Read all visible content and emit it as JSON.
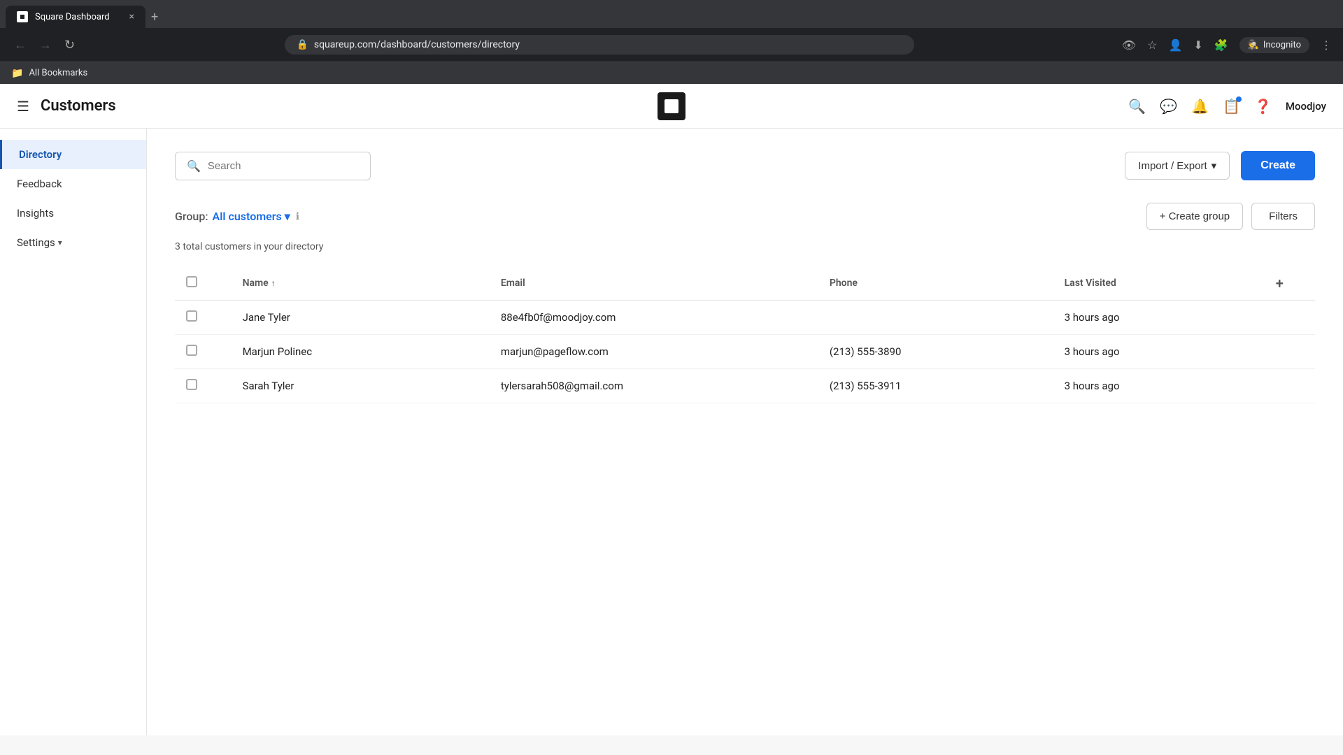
{
  "browser": {
    "tab_title": "Square Dashboard",
    "address": "squareup.com/dashboard/customers/directory",
    "new_tab_label": "+",
    "close_tab": "×",
    "back_btn": "←",
    "forward_btn": "→",
    "refresh_btn": "↻",
    "incognito_label": "Incognito",
    "bookmarks_label": "All Bookmarks"
  },
  "header": {
    "hamburger": "☰",
    "app_title": "Customers",
    "user_name": "Moodjoy"
  },
  "sidebar": {
    "items": [
      {
        "label": "Directory",
        "active": true
      },
      {
        "label": "Feedback",
        "active": false
      },
      {
        "label": "Insights",
        "active": false
      },
      {
        "label": "Settings",
        "active": false
      }
    ]
  },
  "toolbar": {
    "search_placeholder": "Search",
    "import_export_label": "Import / Export",
    "import_export_chevron": "▾",
    "create_label": "Create"
  },
  "group_section": {
    "group_label": "Group:",
    "group_value": "All customers",
    "group_chevron": "▾",
    "info_icon": "ℹ",
    "create_group_label": "+ Create group",
    "filters_label": "Filters",
    "customer_count": "3 total customers in your directory"
  },
  "table": {
    "columns": [
      "",
      "Name",
      "Email",
      "Phone",
      "Last Visited",
      ""
    ],
    "sort_icon": "↑",
    "add_col_icon": "+",
    "rows": [
      {
        "name": "Jane Tyler",
        "email": "88e4fb0f@moodjoy.com",
        "phone": "",
        "last_visited": "3 hours ago"
      },
      {
        "name": "Marjun Polinec",
        "email": "marjun@pageflow.com",
        "phone": "(213) 555-3890",
        "last_visited": "3 hours ago"
      },
      {
        "name": "Sarah Tyler",
        "email": "tylersarah508@gmail.com",
        "phone": "(213) 555-3911",
        "last_visited": "3 hours ago"
      }
    ]
  }
}
